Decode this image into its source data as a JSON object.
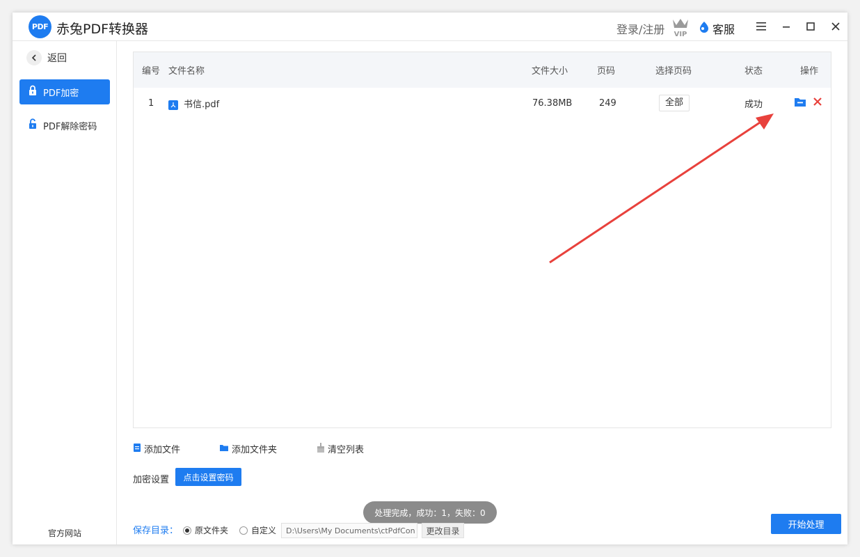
{
  "app": {
    "logo_text": "PDF",
    "title": "赤兔PDF转换器",
    "login": "登录/注册",
    "vip": "VIP",
    "service": "客服",
    "accent_color": "#1e7cf0"
  },
  "sidebar": {
    "back": "返回",
    "items": [
      {
        "label": "PDF加密",
        "active": true
      },
      {
        "label": "PDF解除密码",
        "active": false
      }
    ],
    "official_site": "官方网站"
  },
  "table": {
    "headers": {
      "index": "编号",
      "name": "文件名称",
      "size": "文件大小",
      "pages": "页码",
      "select_pages": "选择页码",
      "status": "状态",
      "actions": "操作"
    },
    "rows": [
      {
        "index": "1",
        "name": "书信.pdf",
        "size": "76.38MB",
        "pages": "249",
        "select_pages": "全部",
        "status": "成功"
      }
    ]
  },
  "toolbar": {
    "add_file": "添加文件",
    "add_folder": "添加文件夹",
    "clear_list": "清空列表"
  },
  "encrypt": {
    "label": "加密设置",
    "button": "点击设置密码"
  },
  "toast": "处理完成，成功：1，失败：0",
  "save": {
    "label": "保存目录：",
    "option_original": "原文件夹",
    "option_custom": "自定义",
    "path": "D:\\Users\\My Documents\\ctPdfCon",
    "change_button": "更改目录",
    "selected": "原文件夹"
  },
  "start_button": "开始处理"
}
